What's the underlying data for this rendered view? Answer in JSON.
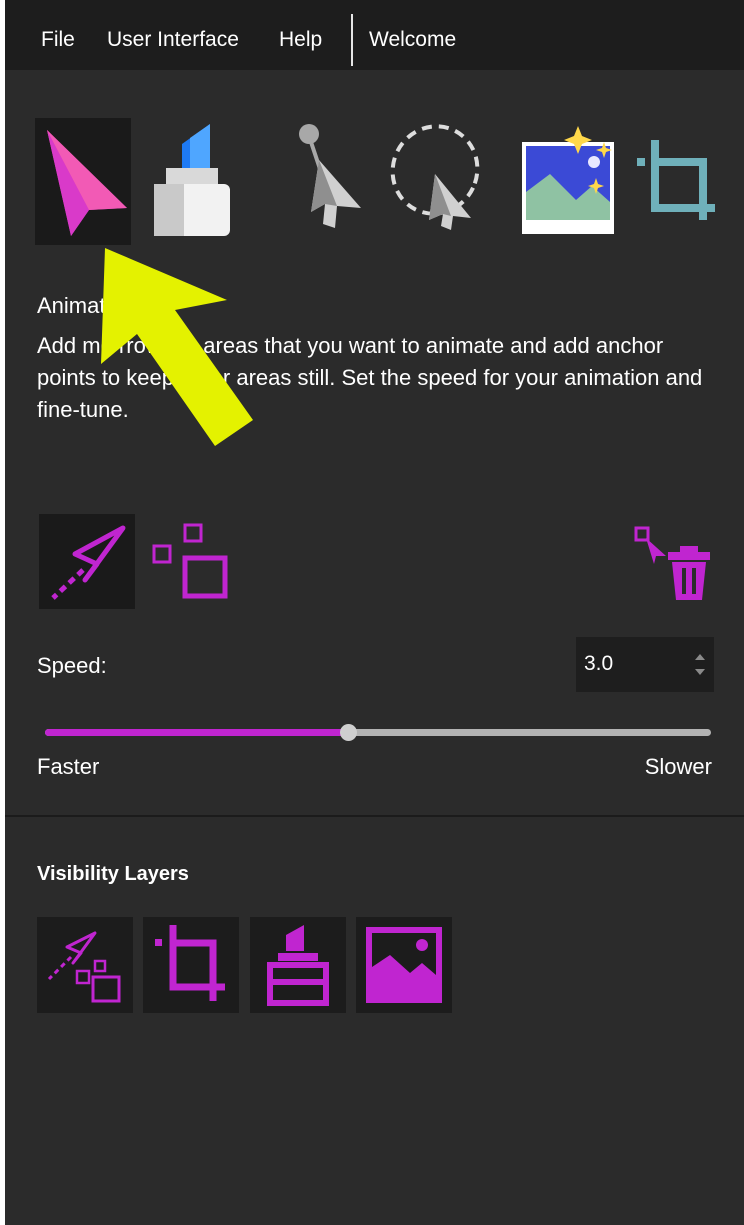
{
  "menubar": {
    "file": "File",
    "user_interface": "User Interface",
    "help": "Help",
    "welcome": "Welcome"
  },
  "toolbar": {
    "tools": [
      {
        "name": "animate-tool",
        "icon": "paper-plane-icon",
        "selected": true
      },
      {
        "name": "highlighter-tool",
        "icon": "marker-icon"
      },
      {
        "name": "pin-pointer-tool",
        "icon": "pin-pointer-icon"
      },
      {
        "name": "lasso-select-tool",
        "icon": "lasso-icon"
      },
      {
        "name": "sky-replace-tool",
        "icon": "sky-image-icon"
      },
      {
        "name": "crop-tool",
        "icon": "crop-icon"
      }
    ]
  },
  "panel": {
    "title": "Animat",
    "description": "Add mo      rrows to areas that you want to animate and add anchor points to keep other areas still. Set the speed for your animation and fine-tune."
  },
  "modes": {
    "motion_arrow": "motion-arrow-icon",
    "anchor_points": "anchor-points-icon",
    "delete": "delete-points-icon"
  },
  "speed": {
    "label": "Speed:",
    "value": "3.0",
    "level": 0.455,
    "faster_label": "Faster",
    "slower_label": "Slower"
  },
  "layers": {
    "title": "Visibility Layers",
    "buttons": [
      "motion-layer-icon",
      "crop-layer-icon",
      "mask-layer-icon",
      "image-layer-icon"
    ]
  },
  "colors": {
    "accent": "#c025d0",
    "background": "#2b2b2b",
    "menubar": "#1d1d1d",
    "annotation": "#e4f200"
  }
}
